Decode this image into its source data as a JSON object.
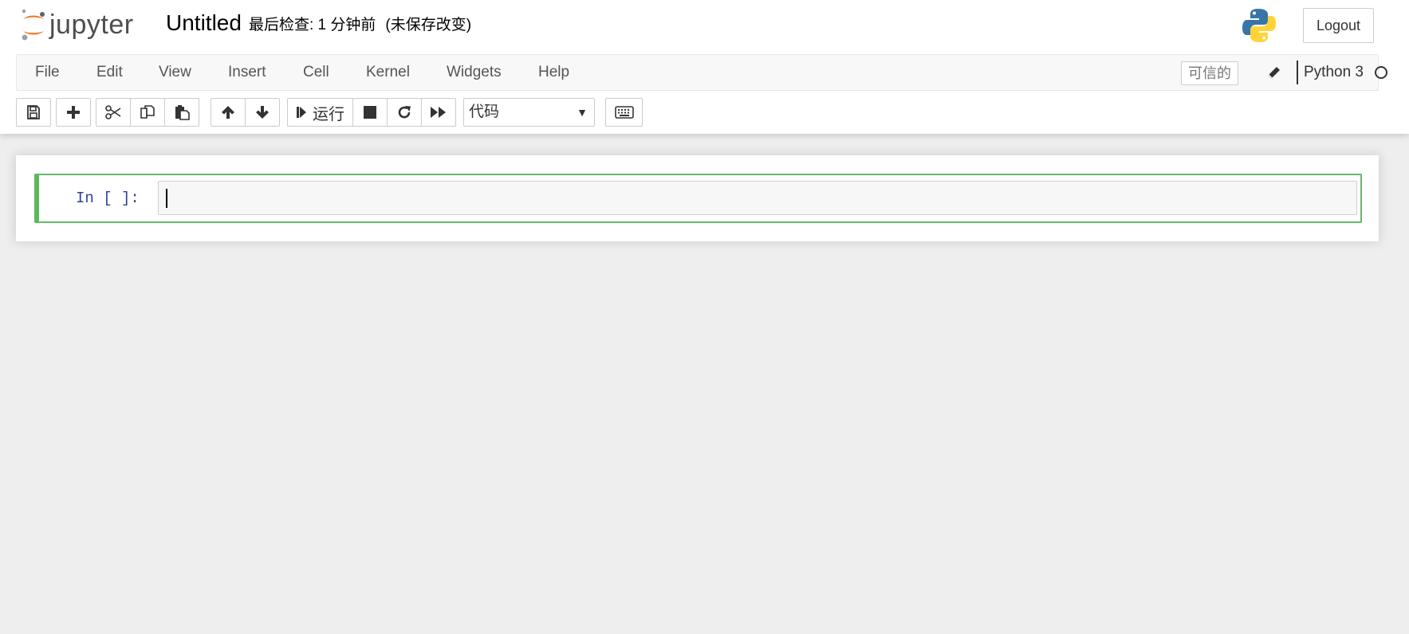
{
  "header": {
    "logo_text": "jupyter",
    "notebook_title": "Untitled",
    "checkpoint_text": "最后检查: 1 分钟前",
    "autosave_status": "(未保存改变)",
    "logout_label": "Logout"
  },
  "menubar": {
    "items": [
      {
        "label": "File"
      },
      {
        "label": "Edit"
      },
      {
        "label": "View"
      },
      {
        "label": "Insert"
      },
      {
        "label": "Cell"
      },
      {
        "label": "Kernel"
      },
      {
        "label": "Widgets"
      },
      {
        "label": "Help"
      }
    ],
    "trusted_label": "可信的",
    "kernel_name": "Python 3",
    "kernel_status": "idle"
  },
  "toolbar": {
    "run_label": "运行",
    "cell_type_selected": "代码",
    "icons": [
      "save-icon",
      "plus-icon",
      "cut-icon",
      "copy-icon",
      "paste-icon",
      "arrow-up-icon",
      "arrow-down-icon",
      "step-forward-icon",
      "stop-icon",
      "restart-icon",
      "fast-forward-icon",
      "keyboard-icon"
    ]
  },
  "cells": [
    {
      "type": "code",
      "prompt": "In [ ]:",
      "source": ""
    }
  ],
  "colors": {
    "cell_border_active": "#66bb6a",
    "prompt": "#303f9f",
    "logo_orange": "#f37726",
    "python_blue": "#3775a9",
    "python_yellow": "#ffd43b"
  }
}
